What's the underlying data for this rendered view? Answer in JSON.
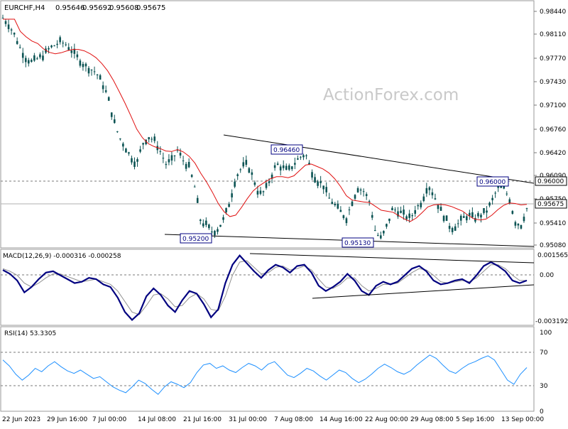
{
  "chart_data": [
    {
      "type": "candlestick",
      "symbol": "EURCHF,H4",
      "ohlc": [
        "0.95646",
        "0.95692",
        "0.95608",
        "0.95675"
      ],
      "watermark": "ActionForex.com",
      "ylim": [
        0.9505,
        0.9862
      ],
      "y_ticks": [
        "0.98440",
        "0.98110",
        "0.97770",
        "0.97430",
        "0.97100",
        "0.96760",
        "0.96420",
        "0.96090",
        "0.95750",
        "0.95410",
        "0.95080"
      ],
      "ma_label": "",
      "current_price": "0.95675",
      "level_line": "0.96000",
      "annotations": [
        {
          "label": "0.96460",
          "value": 0.9646
        },
        {
          "label": "0.96000",
          "value": 0.96
        },
        {
          "label": "0.95200",
          "value": 0.952
        },
        {
          "label": "0.95130",
          "value": 0.9513
        }
      ],
      "price_series": [
        0.984,
        0.983,
        0.9815,
        0.9795,
        0.978,
        0.9775,
        0.978,
        0.9785,
        0.9795,
        0.98,
        0.9805,
        0.98,
        0.979,
        0.978,
        0.977,
        0.9765,
        0.976,
        0.9745,
        0.9725,
        0.969,
        0.9665,
        0.965,
        0.9635,
        0.9625,
        0.9655,
        0.9665,
        0.966,
        0.9645,
        0.9625,
        0.963,
        0.9645,
        0.963,
        0.962,
        0.959,
        0.954,
        0.9535,
        0.9525,
        0.953,
        0.9545,
        0.957,
        0.9605,
        0.962,
        0.9625,
        0.9605,
        0.958,
        0.9585,
        0.9605,
        0.9625,
        0.962,
        0.9615,
        0.9625,
        0.9635,
        0.964,
        0.9615,
        0.96,
        0.9595,
        0.9575,
        0.9565,
        0.9555,
        0.9545,
        0.957,
        0.959,
        0.9585,
        0.957,
        0.9525,
        0.9515,
        0.9535,
        0.956,
        0.9555,
        0.955,
        0.9545,
        0.956,
        0.957,
        0.9595,
        0.958,
        0.956,
        0.9545,
        0.953,
        0.9535,
        0.9545,
        0.955,
        0.9545,
        0.955,
        0.9555,
        0.957,
        0.959,
        0.959,
        0.9575,
        0.954,
        0.9535,
        0.956
      ]
    },
    {
      "type": "line",
      "title": "MACD(12,26,9) -0.000316 -0.000258",
      "ylim": [
        -0.0036,
        0.0018
      ],
      "y_ticks": [
        "0.001565",
        "0.00",
        "-0.003192"
      ],
      "series": [
        {
          "values": [
            0.0005,
            0.0002,
            -0.0003,
            -0.0012,
            -0.0008,
            -0.0002,
            0.0003,
            0.0004,
            0.0001,
            -0.0002,
            -0.0005,
            -0.0004,
            -0.0001,
            -0.0002,
            -0.0006,
            -0.0008,
            -0.0016,
            -0.0027,
            -0.0033,
            -0.0028,
            -0.0015,
            -0.0009,
            -0.0014,
            -0.0022,
            -0.0027,
            -0.0018,
            -0.0011,
            -0.0013,
            -0.0021,
            -0.0031,
            -0.0025,
            -0.0005,
            0.0009,
            0.0016,
            0.001,
            0.0004,
            -0.0001,
            0.0005,
            0.0009,
            0.0007,
            0.0003,
            0.0008,
            0.0009,
            0.0003,
            -0.0007,
            -0.0011,
            -0.0008,
            -0.0004,
            0.0002,
            -0.0003,
            -0.0011,
            -0.0014,
            -0.0007,
            -0.0004,
            -0.0006,
            -0.0004,
            0.0001,
            0.0006,
            0.0008,
            0.0004,
            -0.0003,
            -0.0006,
            -0.0005,
            -0.0003,
            -0.0002,
            -0.0005,
            0.0001,
            0.0008,
            0.0011,
            0.0008,
            0.0004,
            -0.0003,
            -0.0005,
            -0.0003
          ]
        },
        {
          "values": [
            0.0006,
            0.0004,
            0.0001,
            -0.0005,
            -0.0008,
            -0.0005,
            -0.0001,
            0.0002,
            0.0002,
            0.0,
            -0.0002,
            -0.0004,
            -0.0003,
            -0.0002,
            -0.0004,
            -0.0006,
            -0.0011,
            -0.0019,
            -0.0027,
            -0.0029,
            -0.0022,
            -0.0014,
            -0.0013,
            -0.0017,
            -0.0023,
            -0.0022,
            -0.0016,
            -0.0013,
            -0.0017,
            -0.0025,
            -0.0026,
            -0.0015,
            0.0001,
            0.0011,
            0.0012,
            0.0007,
            0.0002,
            0.0003,
            0.0007,
            0.0008,
            0.0005,
            0.0006,
            0.0008,
            0.0005,
            -0.0002,
            -0.0008,
            -0.0009,
            -0.0006,
            -0.0001,
            -0.0001,
            -0.0007,
            -0.0011,
            -0.0009,
            -0.0006,
            -0.0006,
            -0.0005,
            -0.0001,
            0.0003,
            0.0006,
            0.0005,
            0.0001,
            -0.0004,
            -0.0005,
            -0.0004,
            -0.0003,
            -0.0004,
            -0.0001,
            0.0004,
            0.0009,
            0.0009,
            0.0006,
            0.0001,
            -0.0003,
            -0.0003
          ]
        }
      ]
    },
    {
      "type": "line",
      "title": "RSI(14) 53.3305",
      "ylim": [
        0,
        100
      ],
      "y_ticks": [
        "100",
        "70",
        "30",
        "0"
      ],
      "levels": [
        70,
        30
      ],
      "series": [
        {
          "values": [
            62,
            55,
            45,
            38,
            44,
            52,
            48,
            55,
            60,
            54,
            49,
            46,
            50,
            45,
            40,
            42,
            36,
            30,
            26,
            23,
            30,
            38,
            34,
            27,
            21,
            30,
            36,
            33,
            29,
            35,
            47,
            56,
            58,
            52,
            55,
            50,
            47,
            53,
            58,
            55,
            50,
            57,
            60,
            52,
            44,
            41,
            46,
            52,
            49,
            43,
            38,
            44,
            50,
            47,
            40,
            35,
            39,
            45,
            52,
            57,
            53,
            48,
            45,
            49,
            56,
            62,
            68,
            64,
            56,
            49,
            46,
            52,
            57,
            60,
            64,
            67,
            62,
            50,
            38,
            33,
            45,
            53
          ]
        }
      ]
    }
  ],
  "x_ticks": [
    "22 Jun 2023",
    "29 Jun 16:00",
    "7 Jul 00:00",
    "14 Jul 08:00",
    "21 Jul 16:00",
    "31 Jul 00:00",
    "7 Aug 08:00",
    "14 Aug 16:00",
    "22 Aug 00:00",
    "29 Aug 08:00",
    "5 Sep 16:00",
    "13 Sep 00:00"
  ],
  "colors": {
    "candle": "#0b5353",
    "ma": "#e01010",
    "macd": "#000080",
    "signal": "#909090",
    "rsi": "#1e90ff",
    "annotation_text": "#000080",
    "grid_dash": "#7a7a7a"
  }
}
